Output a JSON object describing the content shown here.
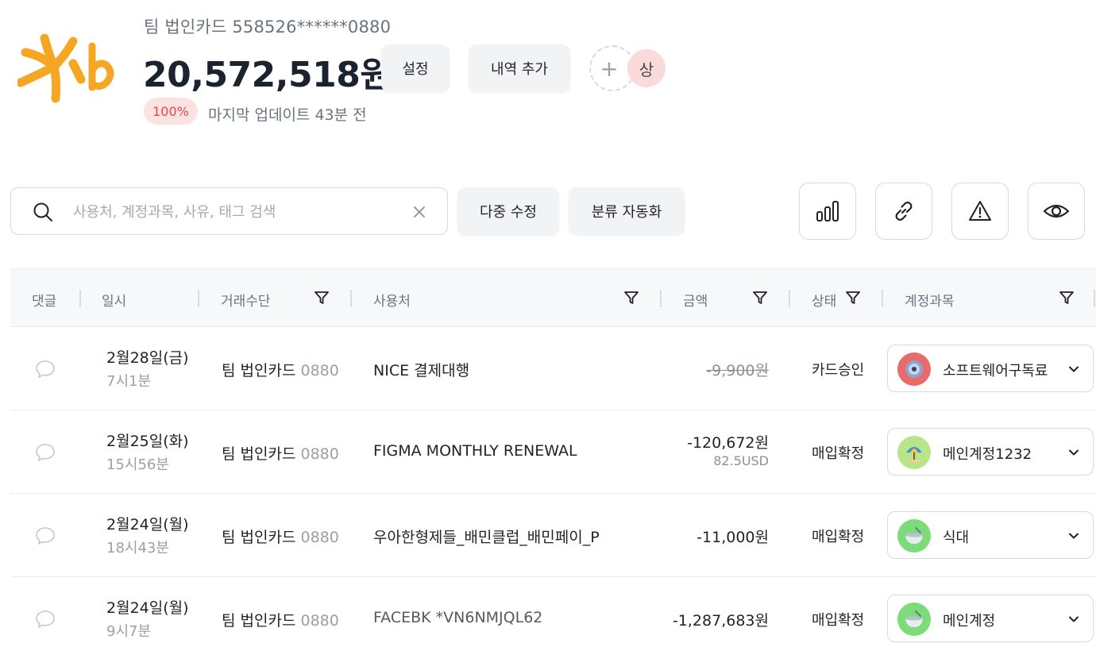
{
  "header": {
    "card_name": "팀 법인카드 558526******0880",
    "balance": "20,572,518원",
    "settings_label": "설정",
    "add_history_label": "내역 추가",
    "member_initial": "상",
    "usage_percent": "100%",
    "last_update": "마지막 업데이트 43분 전",
    "brand_color": "#f5a623"
  },
  "toolbar": {
    "search_placeholder": "사용처, 계정과목, 사유, 태그 검색",
    "search_value": "",
    "bulk_edit_label": "다중 수정",
    "auto_classify_label": "분류 자동화",
    "icon_buttons": [
      "bar-chart-icon",
      "link-icon",
      "warning-icon",
      "eye-icon"
    ]
  },
  "table": {
    "headers": {
      "comment": "댓글",
      "datetime": "일시",
      "payment": "거래수단",
      "merchant": "사용처",
      "amount": "금액",
      "status": "상태",
      "account": "계정과목"
    },
    "rows": [
      {
        "date": "2월28일(금)",
        "time": "7시1분",
        "card": "팀 법인카드",
        "card_last4": "0880",
        "merchant": "NICE 결제대행",
        "amount": "-9,900원",
        "amount_sub": "",
        "strikethrough": true,
        "status": "카드승인",
        "account": "소프트웨어구독료",
        "account_icon": "disc-icon",
        "account_icon_bg": "#e86b6b"
      },
      {
        "date": "2월25일(화)",
        "time": "15시56분",
        "card": "팀 법인카드",
        "card_last4": "0880",
        "merchant": "FIGMA MONTHLY RENEWAL",
        "amount": "-120,672원",
        "amount_sub": "82.5USD",
        "strikethrough": false,
        "status": "매입확정",
        "account": "메인계정1232",
        "account_icon": "beach-umbrella-icon",
        "account_icon_bg": "#b9e58a"
      },
      {
        "date": "2월24일(월)",
        "time": "18시43분",
        "card": "팀 법인카드",
        "card_last4": "0880",
        "merchant": "우아한형제들_배민클럽_배민페이_P",
        "amount": "-11,000원",
        "amount_sub": "",
        "strikethrough": false,
        "status": "매입확정",
        "account": "식대",
        "account_icon": "bowl-icon",
        "account_icon_bg": "#7ddc7a"
      },
      {
        "date": "2월24일(월)",
        "time": "9시7분",
        "card": "팀 법인카드",
        "card_last4": "0880",
        "merchant": "FACEBK *VN6NMJQL62",
        "amount": "-1,287,683원",
        "amount_sub": "",
        "strikethrough": false,
        "status": "매입확정",
        "account": "메인계정",
        "account_icon": "bowl-icon",
        "account_icon_bg": "#7ddc7a"
      }
    ]
  }
}
